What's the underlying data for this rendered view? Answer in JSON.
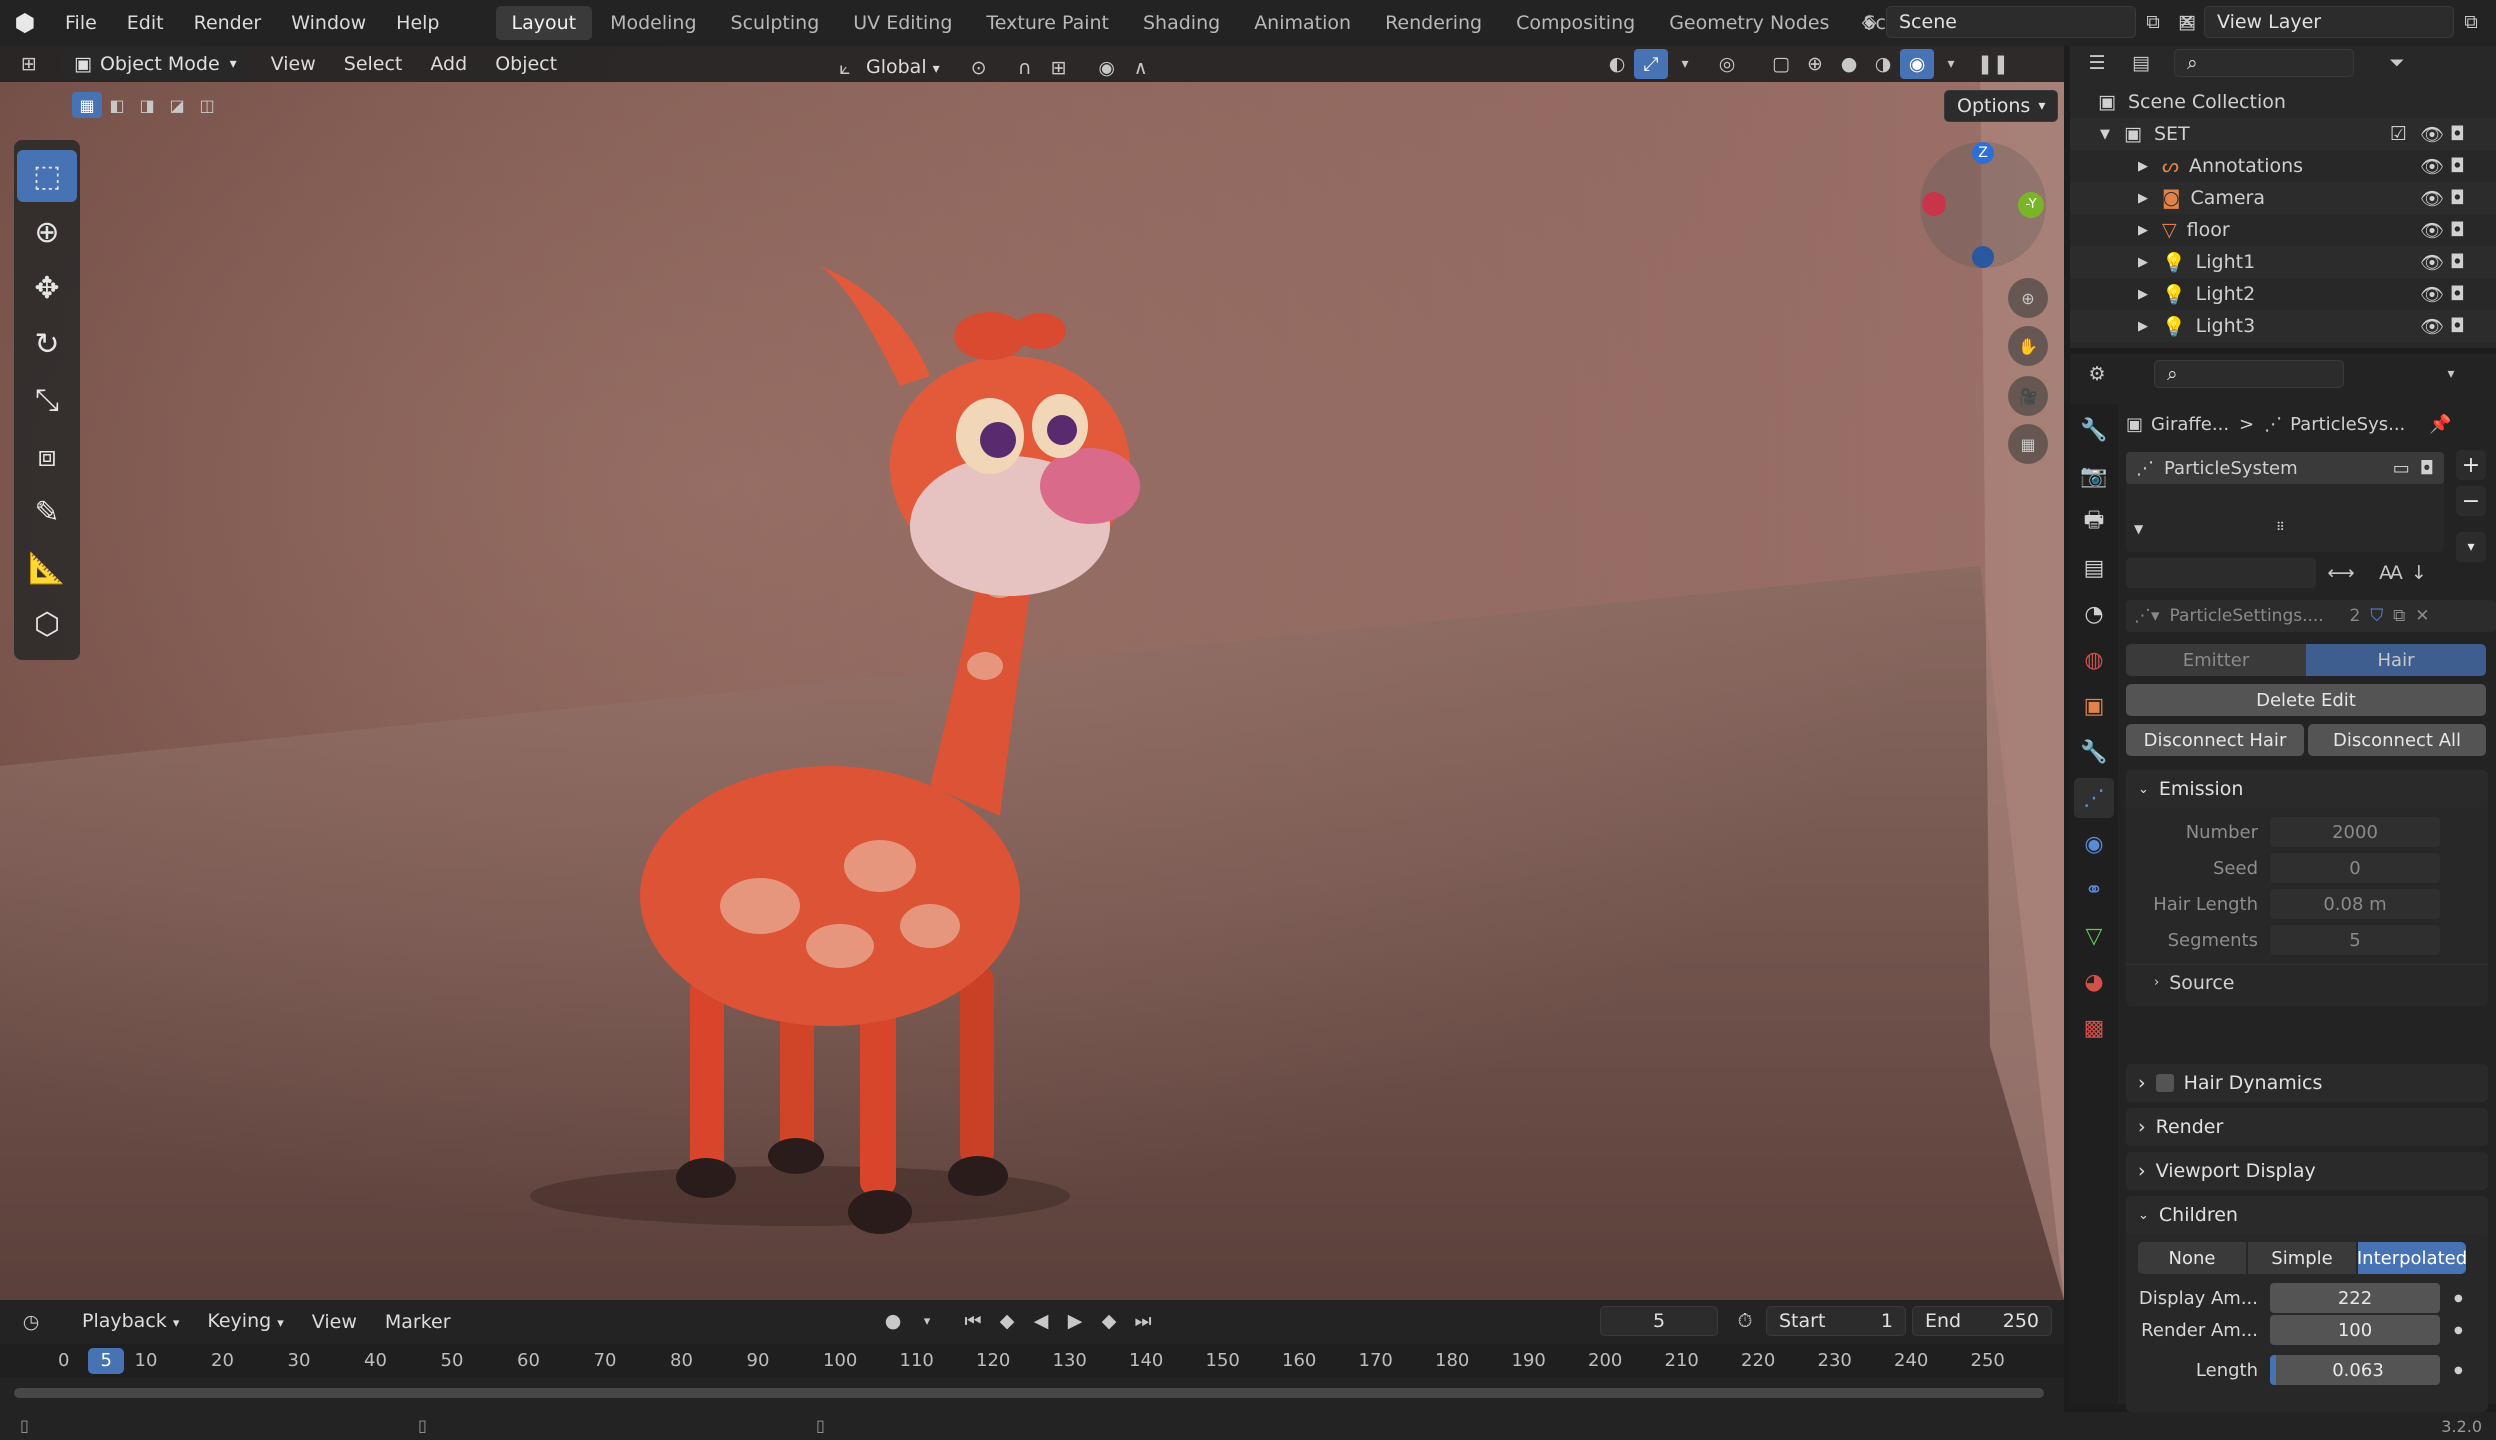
{
  "topbar": {
    "menus": [
      "File",
      "Edit",
      "Render",
      "Window",
      "Help"
    ],
    "workspaces": [
      "Layout",
      "Modeling",
      "Sculpting",
      "UV Editing",
      "Texture Paint",
      "Shading",
      "Animation",
      "Rendering",
      "Compositing",
      "Geometry Nodes",
      "Scripting"
    ],
    "active_workspace": "Layout",
    "add_tab": "+",
    "scene": "Scene",
    "view_layer": "View Layer"
  },
  "viewport": {
    "mode": "Object Mode",
    "menus": [
      "View",
      "Select",
      "Add",
      "Object"
    ],
    "orientation": "Global",
    "options_label": "Options",
    "gizmo": {
      "z": "Z",
      "y": "-Y"
    }
  },
  "outliner": {
    "root": "Scene Collection",
    "collection": "SET",
    "items": [
      "Annotations",
      "Camera",
      "floor",
      "Light1",
      "Light2",
      "Light3"
    ]
  },
  "properties": {
    "breadcrumb_object": "Giraffe...",
    "breadcrumb_sep": ">",
    "breadcrumb_system": "ParticleSys...",
    "particle_system": "ParticleSystem",
    "settings_name": "ParticleSettings....",
    "settings_users": "2",
    "type_emitter": "Emitter",
    "type_hair": "Hair",
    "delete_edit": "Delete Edit",
    "disconnect_hair": "Disconnect Hair",
    "disconnect_all": "Disconnect All",
    "emission": {
      "title": "Emission",
      "number_label": "Number",
      "number": "2000",
      "seed_label": "Seed",
      "seed": "0",
      "hair_length_label": "Hair Length",
      "hair_length": "0.08 m",
      "segments_label": "Segments",
      "segments": "5",
      "source": "Source"
    },
    "panels": [
      "Hair Dynamics",
      "Render",
      "Viewport Display"
    ],
    "children": {
      "title": "Children",
      "options": [
        "None",
        "Simple",
        "Interpolated"
      ],
      "active": "Interpolated",
      "display_amount_label": "Display Am...",
      "display_amount": "222",
      "render_amount_label": "Render Am...",
      "render_amount": "100",
      "length_label": "Length",
      "length": "0.063"
    }
  },
  "timeline": {
    "menus": [
      "Playback",
      "Keying",
      "View",
      "Marker"
    ],
    "current_frame": "5",
    "start_label": "Start",
    "start": "1",
    "end_label": "End",
    "end": "250",
    "ticks": [
      "0",
      "10",
      "20",
      "30",
      "40",
      "50",
      "60",
      "70",
      "80",
      "90",
      "100",
      "110",
      "120",
      "130",
      "140",
      "150",
      "160",
      "170",
      "180",
      "190",
      "200",
      "210",
      "220",
      "230",
      "240",
      "250"
    ],
    "playhead": "5"
  },
  "statusbar": {
    "version": "3.2.0"
  },
  "colors": {
    "accent": "#4772b3",
    "header": "#232323",
    "panel": "#282828"
  }
}
